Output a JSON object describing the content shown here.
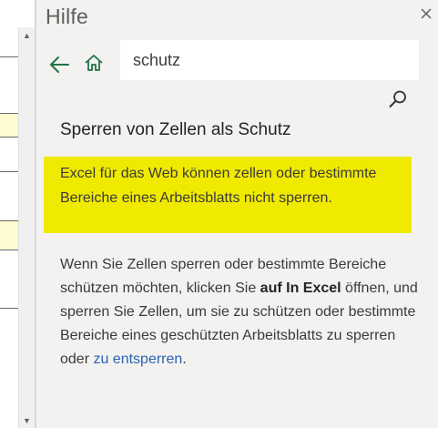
{
  "help_pane": {
    "title": "Hilfe",
    "search": {
      "value": "schutz",
      "placeholder": ""
    },
    "article": {
      "title": "Sperren von Zellen als Schutz",
      "highlight": "Excel für das Web können zellen oder bestimmte Bereiche eines Arbeitsblatts nicht sperren.",
      "body_intro": "Wenn Sie Zellen sperren oder bestimmte Bereiche schützen möchten, klicken Sie ",
      "body_bold": "auf In Excel",
      "body_middle": " öffnen, und sperren Sie Zellen, um sie zu schützen oder bestimmte Bereiche eines geschützten Arbeitsblatts zu sperren oder ",
      "body_link": "zu entsperren",
      "body_end": "."
    }
  },
  "icons": {
    "close": "close-icon",
    "back": "back-arrow-icon",
    "home": "home-icon",
    "search": "search-icon",
    "scroll_up": "scroll-up-icon",
    "scroll_down": "scroll-down-icon"
  },
  "colors": {
    "pane_background": "#f3f2f1",
    "highlight": "#f0ea00",
    "nav_icons": "#217346",
    "link": "#2a63b1",
    "cell_highlight": "#fffbd0"
  }
}
